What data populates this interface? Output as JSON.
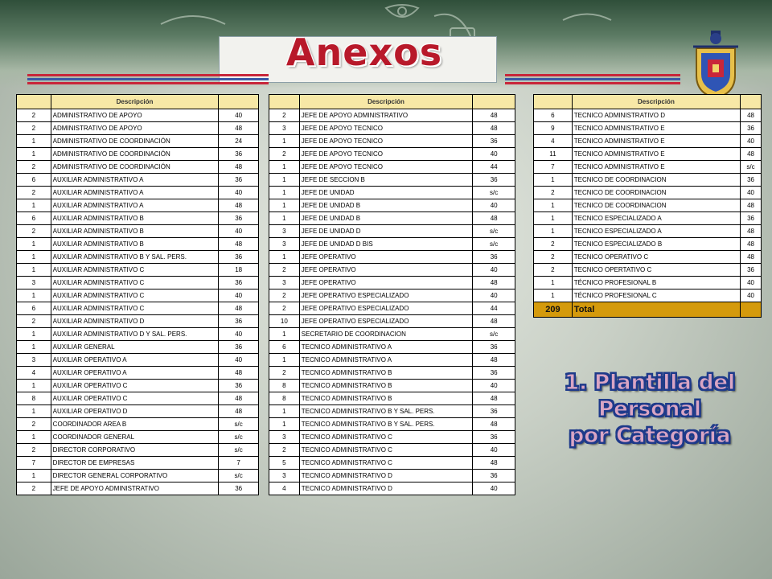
{
  "header": {
    "title": "Anexos"
  },
  "tables": [
    {
      "heading": "Descripción",
      "rows": [
        [
          "2",
          "ADMINISTRATIVO DE APOYO",
          "40"
        ],
        [
          "2",
          "ADMINISTRATIVO DE APOYO",
          "48"
        ],
        [
          "1",
          "ADMINISTRATIVO DE COORDINACIÓN",
          "24"
        ],
        [
          "1",
          "ADMINISTRATIVO DE COORDINACIÓN",
          "36"
        ],
        [
          "2",
          "ADMINISTRATIVO DE COORDINACIÓN",
          "48"
        ],
        [
          "6",
          "AUXILIAR ADMINISTRATIVO A",
          "36"
        ],
        [
          "2",
          "AUXILIAR ADMINISTRATIVO A",
          "40"
        ],
        [
          "1",
          "AUXILIAR ADMINISTRATIVO A",
          "48"
        ],
        [
          "6",
          "AUXILIAR ADMINISTRATIVO B",
          "36"
        ],
        [
          "2",
          "AUXILIAR ADMINISTRATIVO B",
          "40"
        ],
        [
          "1",
          "AUXILIAR ADMINISTRATIVO B",
          "48"
        ],
        [
          "1",
          "AUXILIAR ADMINISTRATIVO B Y SAL. PERS.",
          "36"
        ],
        [
          "1",
          "AUXILIAR ADMINISTRATIVO C",
          "18"
        ],
        [
          "3",
          "AUXILIAR ADMINISTRATIVO C",
          "36"
        ],
        [
          "1",
          "AUXILIAR ADMINISTRATIVO C",
          "40"
        ],
        [
          "6",
          "AUXILIAR ADMINISTRATIVO C",
          "48"
        ],
        [
          "2",
          "AUXILIAR ADMINISTRATIVO D",
          "36"
        ],
        [
          "1",
          "AUXILIAR ADMINISTRATIVO D Y SAL. PERS.",
          "40"
        ],
        [
          "1",
          "AUXILIAR GENERAL",
          "36"
        ],
        [
          "3",
          "AUXILIAR OPERATIVO A",
          "40"
        ],
        [
          "4",
          "AUXILIAR OPERATIVO A",
          "48"
        ],
        [
          "1",
          "AUXILIAR OPERATIVO C",
          "36"
        ],
        [
          "8",
          "AUXILIAR OPERATIVO C",
          "48"
        ],
        [
          "1",
          "AUXILIAR OPERATIVO D",
          "48"
        ],
        [
          "2",
          "COORDINADOR AREA B",
          "s/c"
        ],
        [
          "1",
          "COORDINADOR GENERAL",
          "s/c"
        ],
        [
          "2",
          "DIRECTOR CORPORATIVO",
          "s/c"
        ],
        [
          "7",
          "DIRECTOR DE EMPRESAS",
          "7"
        ],
        [
          "1",
          "DIRECTOR GENERAL CORPORATIVO",
          "s/c"
        ],
        [
          "2",
          "JEFE DE APOYO ADMINISTRATIVO",
          "36"
        ]
      ]
    },
    {
      "heading": "Descripción",
      "rows": [
        [
          "2",
          "JEFE DE APOYO ADMINISTRATIVO",
          "48"
        ],
        [
          "3",
          "JEFE DE APOYO TECNICO",
          "48"
        ],
        [
          "1",
          "JEFE DE APOYO TECNICO",
          "36"
        ],
        [
          "2",
          "JEFE DE APOYO TECNICO",
          "40"
        ],
        [
          "1",
          "JEFE DE APOYO TECNICO",
          "44"
        ],
        [
          "1",
          "JEFE DE SECCION B",
          "36"
        ],
        [
          "1",
          "JEFE DE UNIDAD",
          "s/c"
        ],
        [
          "1",
          "JEFE DE UNIDAD B",
          "40"
        ],
        [
          "1",
          "JEFE DE UNIDAD B",
          "48"
        ],
        [
          "3",
          "JEFE DE UNIDAD D",
          "s/c"
        ],
        [
          "3",
          "JEFE DE UNIDAD D BIS",
          "s/c"
        ],
        [
          "1",
          "JEFE OPERATIVO",
          "36"
        ],
        [
          "2",
          "JEFE OPERATIVO",
          "40"
        ],
        [
          "3",
          "JEFE OPERATIVO",
          "48"
        ],
        [
          "2",
          "JEFE OPERATIVO ESPECIALIZADO",
          "40"
        ],
        [
          "2",
          "JEFE OPERATIVO ESPECIALIZADO",
          "44"
        ],
        [
          "10",
          "JEFE OPERATIVO ESPECIALIZADO",
          "48"
        ],
        [
          "1",
          "SECRETARIO DE COORDINACION",
          "s/c"
        ],
        [
          "6",
          "TECNICO ADMINISTRATIVO A",
          "36"
        ],
        [
          "1",
          "TECNICO ADMINISTRATIVO A",
          "48"
        ],
        [
          "2",
          "TECNICO ADMINISTRATIVO B",
          "36"
        ],
        [
          "8",
          "TECNICO ADMINISTRATIVO B",
          "40"
        ],
        [
          "8",
          "TECNICO ADMINISTRATIVO B",
          "48"
        ],
        [
          "1",
          "TECNICO ADMINISTRATIVO B Y SAL. PERS.",
          "36"
        ],
        [
          "1",
          "TECNICO ADMINISTRATIVO B Y SAL. PERS.",
          "48"
        ],
        [
          "3",
          "TECNICO ADMINISTRATIVO C",
          "36"
        ],
        [
          "2",
          "TECNICO ADMINISTRATIVO C",
          "40"
        ],
        [
          "5",
          "TECNICO ADMINISTRATIVO C",
          "48"
        ],
        [
          "3",
          "TECNICO ADMINISTRATIVO D",
          "36"
        ],
        [
          "4",
          "TECNICO ADMINISTRATIVO D",
          "40"
        ]
      ]
    },
    {
      "heading": "Descripción",
      "rows": [
        [
          "6",
          "TECNICO ADMINISTRATIVO D",
          "48"
        ],
        [
          "9",
          "TECNICO ADMINISTRATIVO E",
          "36"
        ],
        [
          "4",
          "TECNICO ADMINISTRATIVO E",
          "40"
        ],
        [
          "11",
          "TECNICO ADMINISTRATIVO E",
          "48"
        ],
        [
          "7",
          "TECNICO ADMINISTRATIVO E",
          "s/c"
        ],
        [
          "1",
          "TECNICO DE COORDINACION",
          "36"
        ],
        [
          "2",
          "TECNICO DE COORDINACION",
          "40"
        ],
        [
          "1",
          "TECNICO DE COORDINACION",
          "48"
        ],
        [
          "1",
          "TECNICO ESPECIALIZADO A",
          "36"
        ],
        [
          "1",
          "TECNICO ESPECIALIZADO A",
          "48"
        ],
        [
          "2",
          "TECNICO ESPECIALIZADO B",
          "48"
        ],
        [
          "2",
          "TECNICO OPERATIVO C",
          "48"
        ],
        [
          "2",
          "TECNICO OPERTATIVO C",
          "36"
        ],
        [
          "1",
          "TÉCNICO PROFESIONAL B",
          "40"
        ],
        [
          "1",
          "TÉCNICO PROFESIONAL C",
          "40"
        ]
      ],
      "total": {
        "count": "209",
        "label": "Total"
      }
    }
  ],
  "caption": {
    "line1": "1. Plantilla del Personal",
    "line2": "por Categoría"
  },
  "colors": {
    "header_fill": "#f7e8a6",
    "total_fill": "#d49a0c",
    "title_red": "#b8192a",
    "caption_fill": "#d9a5c4",
    "caption_outline": "#1e3a8a"
  }
}
